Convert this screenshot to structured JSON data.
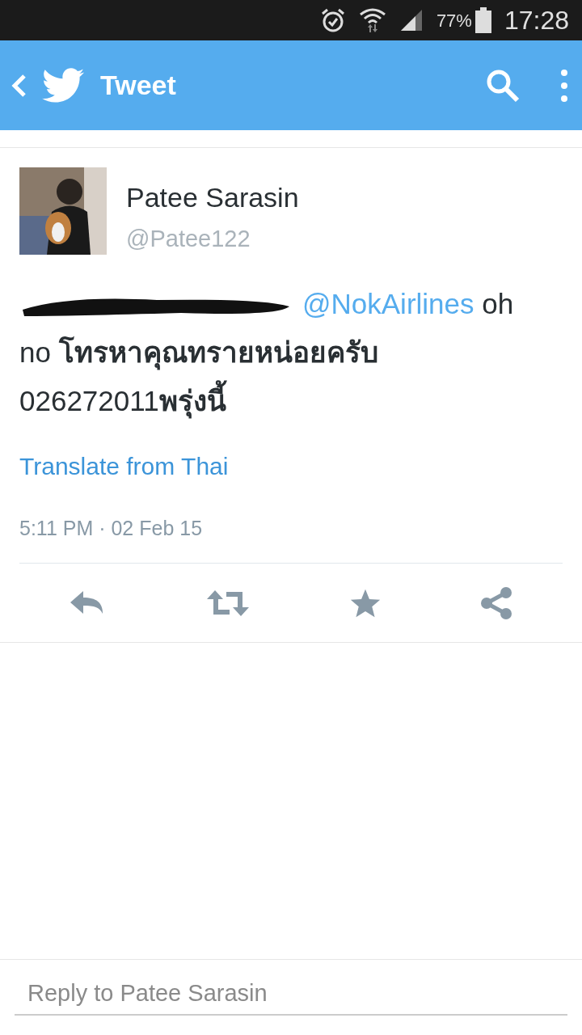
{
  "status_bar": {
    "battery": "77%",
    "time": "17:28"
  },
  "header": {
    "title": "Tweet"
  },
  "tweet": {
    "author": "Patee Sarasin",
    "handle": "@Patee122",
    "redacted_mention": true,
    "mention": "@NokAirlines",
    "text": " oh no **โทรหาคุณทรายหน่อยครับ**\n026272011**พรุ่งนี้**",
    "translate": "Translate from Thai",
    "timestamp": "5:11 PM · 02 Feb 15"
  },
  "actions": [
    {
      "kind": "reply"
    },
    {
      "kind": "retweet"
    },
    {
      "kind": "favorite"
    },
    {
      "kind": "share"
    }
  ],
  "reply_field": {
    "placeholder": "Reply to Patee Sarasin"
  }
}
